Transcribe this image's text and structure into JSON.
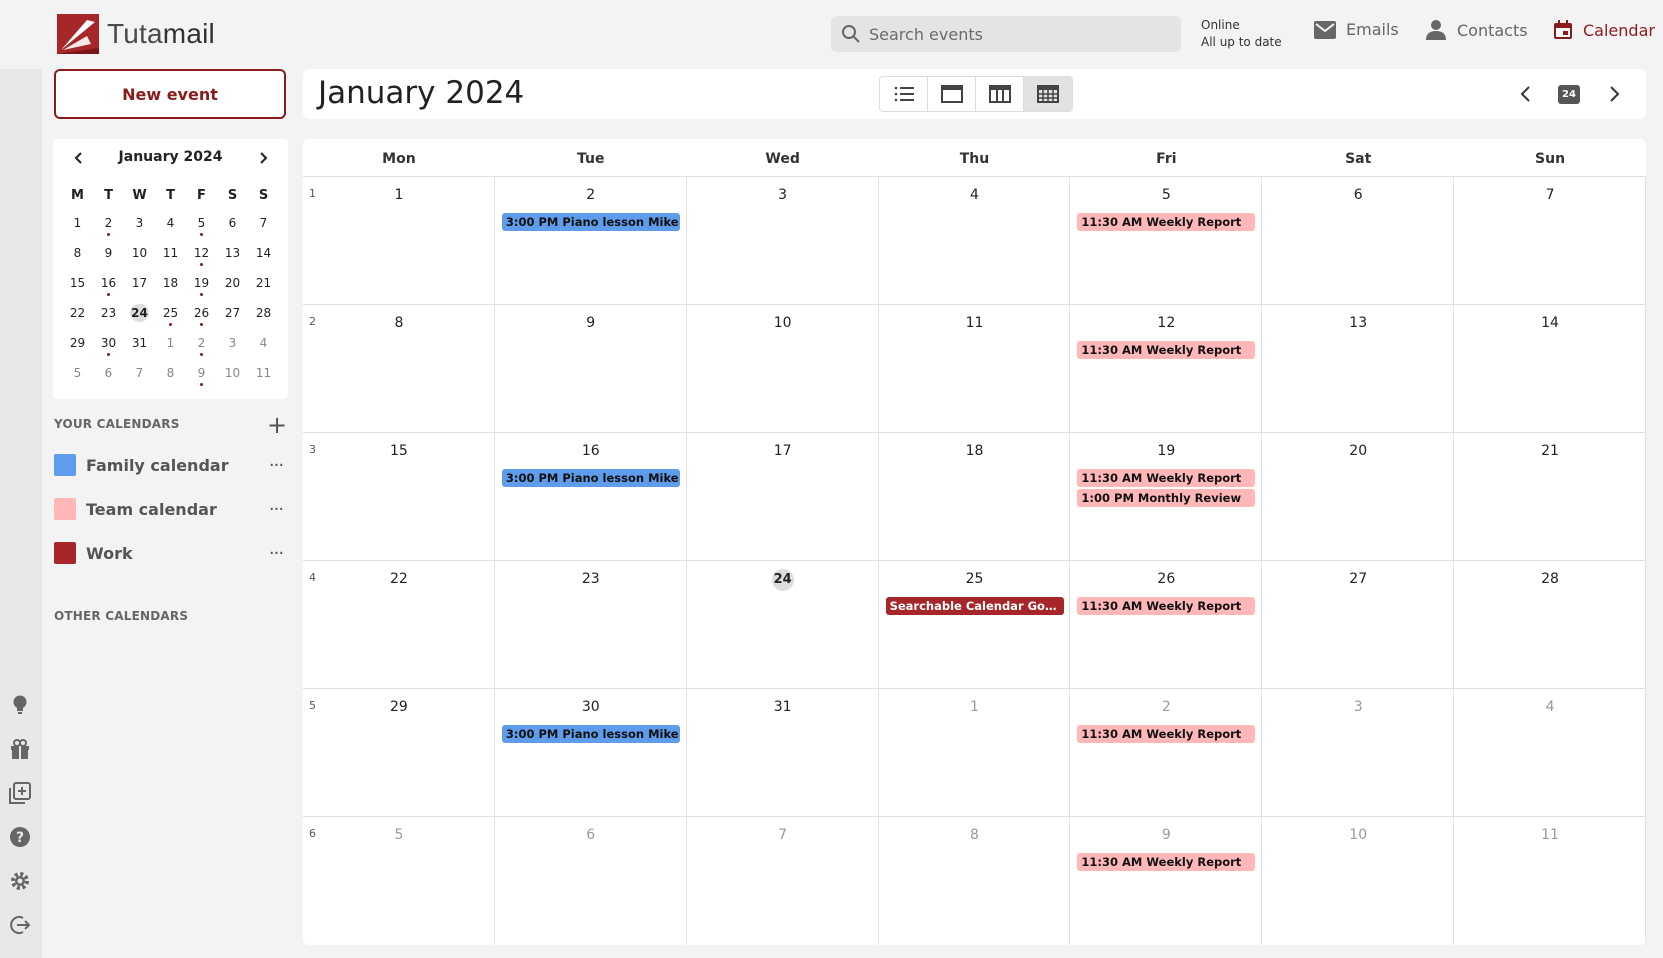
{
  "app": {
    "brand_light": "Tuta",
    "brand_bold": "mail",
    "search_placeholder": "Search events",
    "status_line1": "Online",
    "status_line2": "All up to date",
    "nav": [
      {
        "label": "Emails",
        "icon": "mail-icon"
      },
      {
        "label": "Contacts",
        "icon": "person-icon"
      },
      {
        "label": "Calendar",
        "icon": "calendar-icon",
        "active": true
      }
    ],
    "accent_color": "#8b1c1c"
  },
  "sidebar": {
    "new_event_label": "New event",
    "mini_calendar": {
      "title": "January 2024",
      "weekdays": [
        "M",
        "T",
        "W",
        "T",
        "F",
        "S",
        "S"
      ],
      "days": [
        {
          "d": "1"
        },
        {
          "d": "2",
          "dot": true
        },
        {
          "d": "3"
        },
        {
          "d": "4"
        },
        {
          "d": "5",
          "dot": true
        },
        {
          "d": "6"
        },
        {
          "d": "7"
        },
        {
          "d": "8"
        },
        {
          "d": "9"
        },
        {
          "d": "10"
        },
        {
          "d": "11"
        },
        {
          "d": "12",
          "dot": true
        },
        {
          "d": "13"
        },
        {
          "d": "14"
        },
        {
          "d": "15"
        },
        {
          "d": "16",
          "dot": true
        },
        {
          "d": "17"
        },
        {
          "d": "18"
        },
        {
          "d": "19",
          "dot": true
        },
        {
          "d": "20"
        },
        {
          "d": "21"
        },
        {
          "d": "22"
        },
        {
          "d": "23"
        },
        {
          "d": "24",
          "today": true
        },
        {
          "d": "25",
          "dot": true
        },
        {
          "d": "26",
          "dot": true
        },
        {
          "d": "27"
        },
        {
          "d": "28"
        },
        {
          "d": "29"
        },
        {
          "d": "30",
          "dot": true
        },
        {
          "d": "31"
        },
        {
          "d": "1",
          "other": true
        },
        {
          "d": "2",
          "other": true,
          "dot": true
        },
        {
          "d": "3",
          "other": true
        },
        {
          "d": "4",
          "other": true
        },
        {
          "d": "5",
          "other": true
        },
        {
          "d": "6",
          "other": true
        },
        {
          "d": "7",
          "other": true
        },
        {
          "d": "8",
          "other": true
        },
        {
          "d": "9",
          "other": true,
          "dot": true
        },
        {
          "d": "10",
          "other": true
        },
        {
          "d": "11",
          "other": true
        }
      ]
    },
    "your_calendars_title": "YOUR CALENDARS",
    "calendars": [
      {
        "name": "Family calendar",
        "color": "#5f9cec",
        "more": "···"
      },
      {
        "name": "Team calendar",
        "color": "#ffb7b7",
        "more": "···"
      },
      {
        "name": "Work",
        "color": "#a6262a",
        "more": "···"
      }
    ],
    "other_calendars_title": "OTHER CALENDARS",
    "rail_icons": [
      "lightbulb-icon",
      "gift-icon",
      "add-calendar-icon",
      "help-icon",
      "settings-icon",
      "logout-icon"
    ]
  },
  "toolbar": {
    "title": "January 2024",
    "views": [
      "agenda-view",
      "day-view",
      "week-view",
      "month-view"
    ],
    "selected_view": "month-view",
    "today_label": "24"
  },
  "month": {
    "weekdays": [
      "Mon",
      "Tue",
      "Wed",
      "Thu",
      "Fri",
      "Sat",
      "Sun"
    ],
    "weeks": [
      {
        "num": "1",
        "days": [
          {
            "d": "1"
          },
          {
            "d": "2",
            "events": [
              {
                "text": "3:00 PM Piano lesson Mike",
                "cal": "blue"
              }
            ]
          },
          {
            "d": "3"
          },
          {
            "d": "4"
          },
          {
            "d": "5",
            "events": [
              {
                "text": "11:30 AM Weekly Report",
                "cal": "pink"
              }
            ]
          },
          {
            "d": "6"
          },
          {
            "d": "7"
          }
        ]
      },
      {
        "num": "2",
        "days": [
          {
            "d": "8"
          },
          {
            "d": "9"
          },
          {
            "d": "10"
          },
          {
            "d": "11"
          },
          {
            "d": "12",
            "events": [
              {
                "text": "11:30 AM Weekly Report",
                "cal": "pink"
              }
            ]
          },
          {
            "d": "13"
          },
          {
            "d": "14"
          }
        ]
      },
      {
        "num": "3",
        "days": [
          {
            "d": "15"
          },
          {
            "d": "16",
            "events": [
              {
                "text": "3:00 PM Piano lesson Mike",
                "cal": "blue"
              }
            ]
          },
          {
            "d": "17"
          },
          {
            "d": "18"
          },
          {
            "d": "19",
            "events": [
              {
                "text": "11:30 AM Weekly Report",
                "cal": "pink"
              },
              {
                "text": "1:00 PM Monthly Review",
                "cal": "pink"
              }
            ]
          },
          {
            "d": "20"
          },
          {
            "d": "21"
          }
        ]
      },
      {
        "num": "4",
        "days": [
          {
            "d": "22"
          },
          {
            "d": "23"
          },
          {
            "d": "24",
            "today": true
          },
          {
            "d": "25",
            "events": [
              {
                "text": "Searchable Calendar Goes Live",
                "cal": "red"
              }
            ]
          },
          {
            "d": "26",
            "events": [
              {
                "text": "11:30 AM Weekly Report",
                "cal": "pink"
              }
            ]
          },
          {
            "d": "27"
          },
          {
            "d": "28"
          }
        ]
      },
      {
        "num": "5",
        "days": [
          {
            "d": "29"
          },
          {
            "d": "30",
            "events": [
              {
                "text": "3:00 PM Piano lesson Mike",
                "cal": "blue"
              }
            ]
          },
          {
            "d": "31"
          },
          {
            "d": "1",
            "other": true
          },
          {
            "d": "2",
            "other": true,
            "events": [
              {
                "text": "11:30 AM Weekly Report",
                "cal": "pink"
              }
            ]
          },
          {
            "d": "3",
            "other": true
          },
          {
            "d": "4",
            "other": true
          }
        ]
      },
      {
        "num": "6",
        "days": [
          {
            "d": "5",
            "other": true
          },
          {
            "d": "6",
            "other": true
          },
          {
            "d": "7",
            "other": true
          },
          {
            "d": "8",
            "other": true
          },
          {
            "d": "9",
            "other": true,
            "events": [
              {
                "text": "11:30 AM Weekly Report",
                "cal": "pink"
              }
            ]
          },
          {
            "d": "10",
            "other": true
          },
          {
            "d": "11",
            "other": true
          }
        ]
      }
    ]
  }
}
